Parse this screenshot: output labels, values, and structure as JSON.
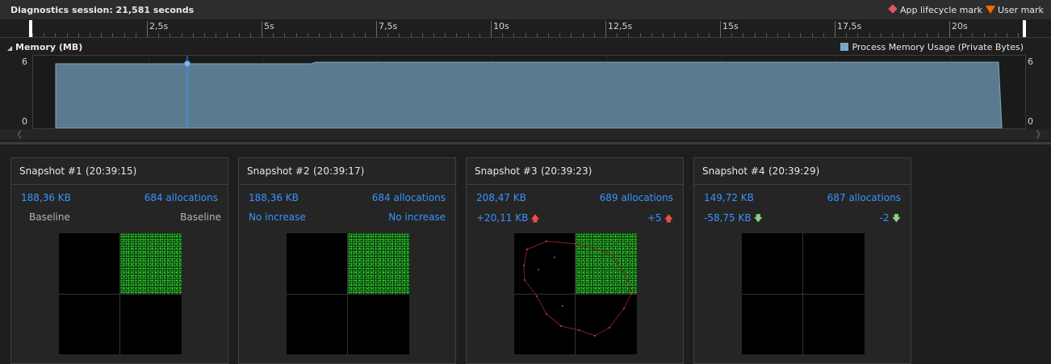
{
  "header": {
    "session_label": "Diagnostics session: 21,581 seconds",
    "lifecycle_mark_label": "App lifecycle mark",
    "user_mark_label": "User mark",
    "lifecycle_color": "#e05561",
    "user_mark_color": "#ff6a00"
  },
  "ruler": {
    "ticks": [
      "2,5s",
      "5s",
      "7,5s",
      "10s",
      "12,5s",
      "15s",
      "17,5s",
      "20s"
    ]
  },
  "memory": {
    "title": "Memory (MB)",
    "legend_label": "Process Memory Usage (Private Bytes)",
    "series_color": "#7fa6c1",
    "y_max_label": "6",
    "y_min_label": "0",
    "y_max_right": "6",
    "y_min_right": "0"
  },
  "snapshots": [
    {
      "title": "Snapshot #1",
      "time": "(20:39:15)",
      "size": "188,36 KB",
      "allocations": "684 allocations",
      "size_diff": "Baseline",
      "alloc_diff": "Baseline",
      "size_trend": "",
      "alloc_trend": ""
    },
    {
      "title": "Snapshot #2",
      "time": "(20:39:17)",
      "size": "188,36 KB",
      "allocations": "684 allocations",
      "size_diff": "No increase",
      "alloc_diff": "No increase",
      "size_trend": "",
      "alloc_trend": ""
    },
    {
      "title": "Snapshot #3",
      "time": "(20:39:23)",
      "size": "208,47 KB",
      "allocations": "689 allocations",
      "size_diff": "+20,11 KB",
      "alloc_diff": "+5",
      "size_trend": "up",
      "alloc_trend": "up"
    },
    {
      "title": "Snapshot #4",
      "time": "(20:39:29)",
      "size": "149,72 KB",
      "allocations": "687 allocations",
      "size_diff": "-58,75 KB",
      "alloc_diff": "-2",
      "size_trend": "down",
      "alloc_trend": "down"
    }
  ]
}
